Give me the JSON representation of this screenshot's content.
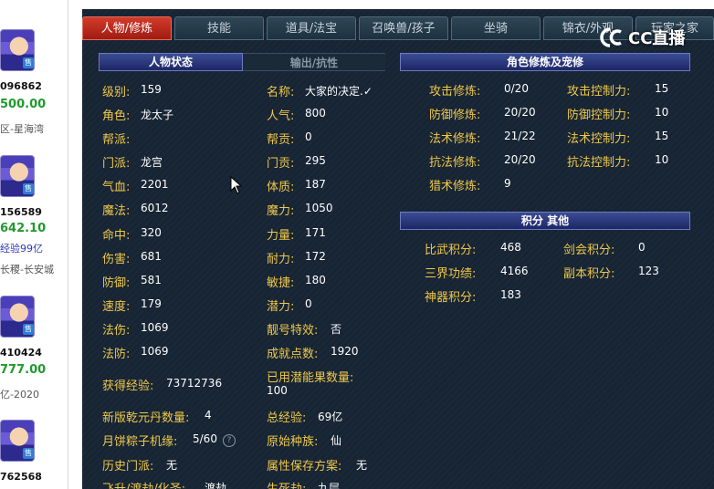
{
  "listings": [
    {
      "id": "096862",
      "price": "500.00",
      "extra": "区-星海湾",
      "extra_style": "grey"
    },
    {
      "id": "156589",
      "price": "642.10",
      "extra": "经验99亿",
      "extra_style": "blue",
      "extra2": "长稷-长安城"
    },
    {
      "id": "410424",
      "price": "777.00",
      "extra": "亿-2020",
      "extra_style": "grey"
    },
    {
      "id": "762568",
      "price": "",
      "extra": "",
      "extra_style": "grey"
    }
  ],
  "listing_badge": "售",
  "tabs": [
    "人物/修炼",
    "技能",
    "道具/法宝",
    "召唤兽/孩子",
    "坐骑",
    "锦衣/外观",
    "玩家之家"
  ],
  "subtabs": {
    "status": "人物状态",
    "output": "输出/抗性"
  },
  "headers": {
    "cultivation": "角色修炼及宠修",
    "points": "积分 其他"
  },
  "stats_left": [
    {
      "label": "级别:",
      "value": "159"
    },
    {
      "label": "角色:",
      "value": "龙太子"
    },
    {
      "label": "帮派:",
      "value": ""
    },
    {
      "label": "门派:",
      "value": "龙宫"
    },
    {
      "label": "气血:",
      "value": "2201"
    },
    {
      "label": "魔法:",
      "value": "6012"
    },
    {
      "label": "命中:",
      "value": "320"
    },
    {
      "label": "伤害:",
      "value": "681"
    },
    {
      "label": "防御:",
      "value": "581"
    },
    {
      "label": "速度:",
      "value": "179"
    },
    {
      "label": "法伤:",
      "value": "1069"
    },
    {
      "label": "法防:",
      "value": "1069"
    },
    {
      "label": "获得经验:",
      "value": "73712736"
    },
    {
      "label": "新版乾元丹数量:",
      "value": "4"
    },
    {
      "label": "月饼粽子机缘:",
      "value": "5/60"
    },
    {
      "label": "历史门派:",
      "value": "无"
    },
    {
      "label": "飞升/渡劫/化圣:",
      "value": "渡劫"
    }
  ],
  "stats_right": [
    {
      "label": "名称:",
      "value": "大家的决定.✓"
    },
    {
      "label": "人气:",
      "value": "800"
    },
    {
      "label": "帮贡:",
      "value": "0"
    },
    {
      "label": "门贡:",
      "value": "295"
    },
    {
      "label": "体质:",
      "value": "187"
    },
    {
      "label": "魔力:",
      "value": "1050"
    },
    {
      "label": "力量:",
      "value": "171"
    },
    {
      "label": "耐力:",
      "value": "172"
    },
    {
      "label": "敏捷:",
      "value": "180"
    },
    {
      "label": "潜力:",
      "value": "0"
    },
    {
      "label": "靓号特效:",
      "value": "否"
    },
    {
      "label": "成就点数:",
      "value": "1920"
    },
    {
      "label": "已用潜能果数量:",
      "value": "100"
    },
    {
      "label": "总经验:",
      "value": "69亿"
    },
    {
      "label": "原始种族:",
      "value": "仙"
    },
    {
      "label": "属性保存方案:",
      "value": "无"
    },
    {
      "label": "生死劫:",
      "value": "九层"
    }
  ],
  "cultivation": [
    {
      "label": "攻击修炼:",
      "value": "0/20"
    },
    {
      "label": "防御修炼:",
      "value": "20/20"
    },
    {
      "label": "法术修炼:",
      "value": "21/22"
    },
    {
      "label": "抗法修炼:",
      "value": "20/20"
    },
    {
      "label": "猎术修炼:",
      "value": "9"
    }
  ],
  "control": [
    {
      "label": "攻击控制力:",
      "value": "15"
    },
    {
      "label": "防御控制力:",
      "value": "10"
    },
    {
      "label": "法术控制力:",
      "value": "15"
    },
    {
      "label": "抗法控制力:",
      "value": "10"
    }
  ],
  "points_left": [
    {
      "label": "比武积分:",
      "value": "468"
    },
    {
      "label": "三界功绩:",
      "value": "4166"
    },
    {
      "label": "神器积分:",
      "value": "183"
    }
  ],
  "points_right": [
    {
      "label": "剑会积分:",
      "value": "0"
    },
    {
      "label": "副本积分:",
      "value": "123"
    }
  ],
  "help_glyph": "?",
  "watermark": {
    "text": "CC直播"
  },
  "colors": {
    "label": "#f0c84a",
    "value": "#ffffff",
    "active_tab": "#c82c1e",
    "price": "#1f9a2d"
  }
}
